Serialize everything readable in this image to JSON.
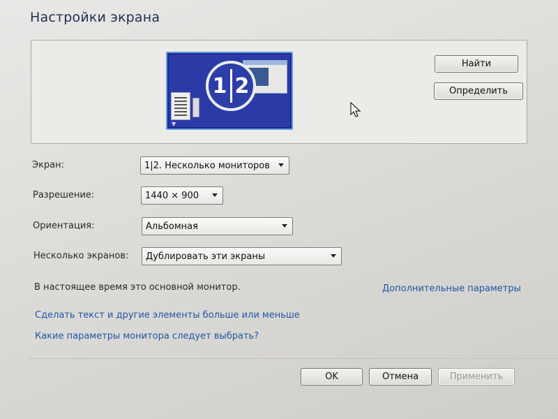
{
  "window": {
    "title": "Настройки экрана"
  },
  "preview": {
    "badge_left": "1",
    "badge_right": "2",
    "identify_find_label": "Найти",
    "identify_label": "Определить"
  },
  "form": {
    "screen_label": "Экран:",
    "screen_value": "1|2. Несколько мониторов",
    "resolution_label": "Разрешение:",
    "resolution_value": "1440 × 900",
    "orientation_label": "Ориентация:",
    "orientation_value": "Альбомная",
    "multiple_label": "Несколько экранов:",
    "multiple_value": "Дублировать эти экраны"
  },
  "status": {
    "primary_text": "В настоящее время это основной монитор.",
    "advanced_link": "Дополнительные параметры"
  },
  "links": {
    "text_size": "Сделать текст и другие элементы больше или меньше",
    "which_settings": "Какие параметры монитора следует выбрать?"
  },
  "footer": {
    "ok_label": "OK",
    "cancel_label": "Отмена",
    "apply_label": "Применить"
  },
  "colors": {
    "accent_link": "#1e56a8",
    "title": "#1e3050",
    "monitor_blue": "#2b3aa6"
  },
  "icons": [
    "monitor-preview-icon",
    "cursor-arrow-icon",
    "chevron-down-icon"
  ]
}
